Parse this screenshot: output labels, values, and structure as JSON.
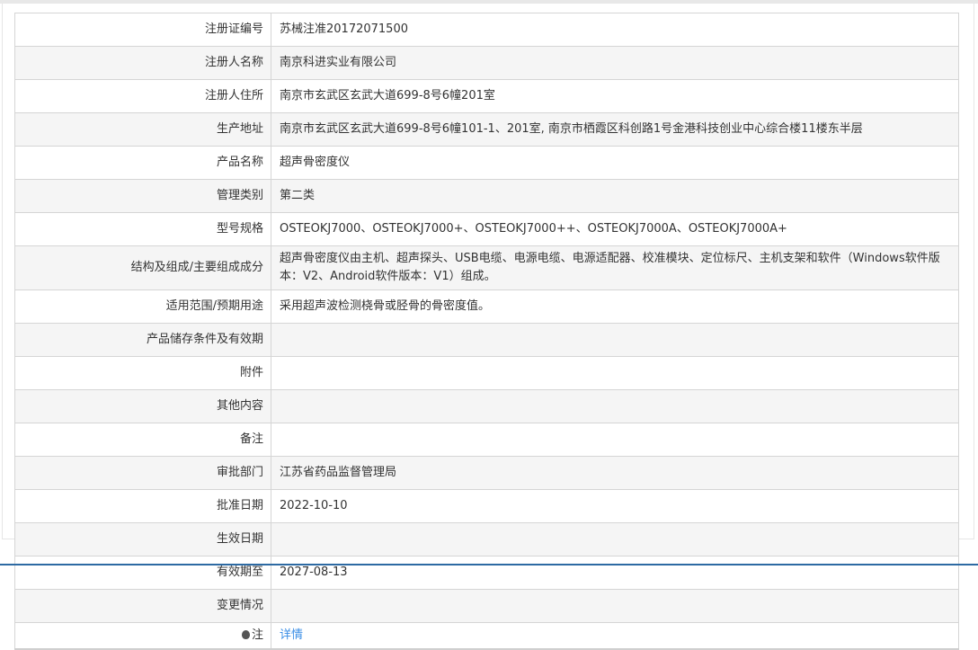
{
  "rows": [
    {
      "label": "注册证编号",
      "value": "苏械注准20172071500"
    },
    {
      "label": "注册人名称",
      "value": "南京科进实业有限公司"
    },
    {
      "label": "注册人住所",
      "value": "南京市玄武区玄武大道699-8号6幢201室"
    },
    {
      "label": "生产地址",
      "value": "南京市玄武区玄武大道699-8号6幢101-1、201室, 南京市栖霞区科创路1号金港科技创业中心综合楼11楼东半层"
    },
    {
      "label": "产品名称",
      "value": "超声骨密度仪"
    },
    {
      "label": "管理类别",
      "value": "第二类"
    },
    {
      "label": "型号规格",
      "value": "OSTEOKJ7000、OSTEOKJ7000+、OSTEOKJ7000++、OSTEOKJ7000A、OSTEOKJ7000A+"
    },
    {
      "label": "结构及组成/主要组成成分",
      "value": "超声骨密度仪由主机、超声探头、USB电缆、电源电缆、电源适配器、校准模块、定位标尺、主机支架和软件（Windows软件版本：V2、Android软件版本：V1）组成。"
    },
    {
      "label": "适用范围/预期用途",
      "value": "采用超声波检测桡骨或胫骨的骨密度值。"
    },
    {
      "label": "产品储存条件及有效期",
      "value": ""
    },
    {
      "label": "附件",
      "value": ""
    },
    {
      "label": "其他内容",
      "value": ""
    },
    {
      "label": "备注",
      "value": ""
    },
    {
      "label": "审批部门",
      "value": "江苏省药品监督管理局"
    },
    {
      "label": "批准日期",
      "value": "2022-10-10"
    },
    {
      "label": "生效日期",
      "value": ""
    },
    {
      "label": "有效期至",
      "value": "2027-08-13"
    },
    {
      "label": "变更情况",
      "value": ""
    }
  ],
  "note": {
    "label": "注",
    "link": "详情"
  }
}
